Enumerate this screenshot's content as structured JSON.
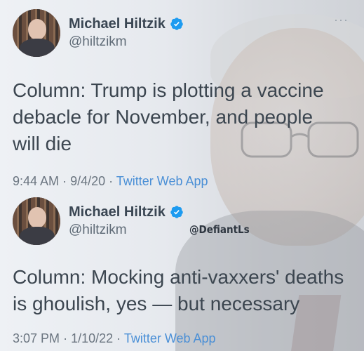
{
  "tweets": [
    {
      "display_name": "Michael Hiltzik",
      "handle": "@hiltzikm",
      "text": "Column: Trump is plotting a vaccine debacle for November, and people will die",
      "time": "9:44 AM",
      "date": "9/4/20",
      "app": "Twitter Web App",
      "verified_icon": "verified-badge-icon"
    },
    {
      "display_name": "Michael Hiltzik",
      "handle": "@hiltzikm",
      "text": "Column: Mocking anti-vaxxers' deaths is ghoulish, yes — but necessary",
      "time": "3:07 PM",
      "date": "1/10/22",
      "app": "Twitter Web App",
      "verified_icon": "verified-badge-icon"
    }
  ],
  "watermark": "@DefiantLs",
  "menu_icon": "more-dots-icon",
  "colors": {
    "name": "#3a4653",
    "handle": "#5f6b77",
    "text": "#3c4650",
    "meta": "#6b7580",
    "link": "#4a8fd6",
    "verified": "#1d9bf0"
  }
}
